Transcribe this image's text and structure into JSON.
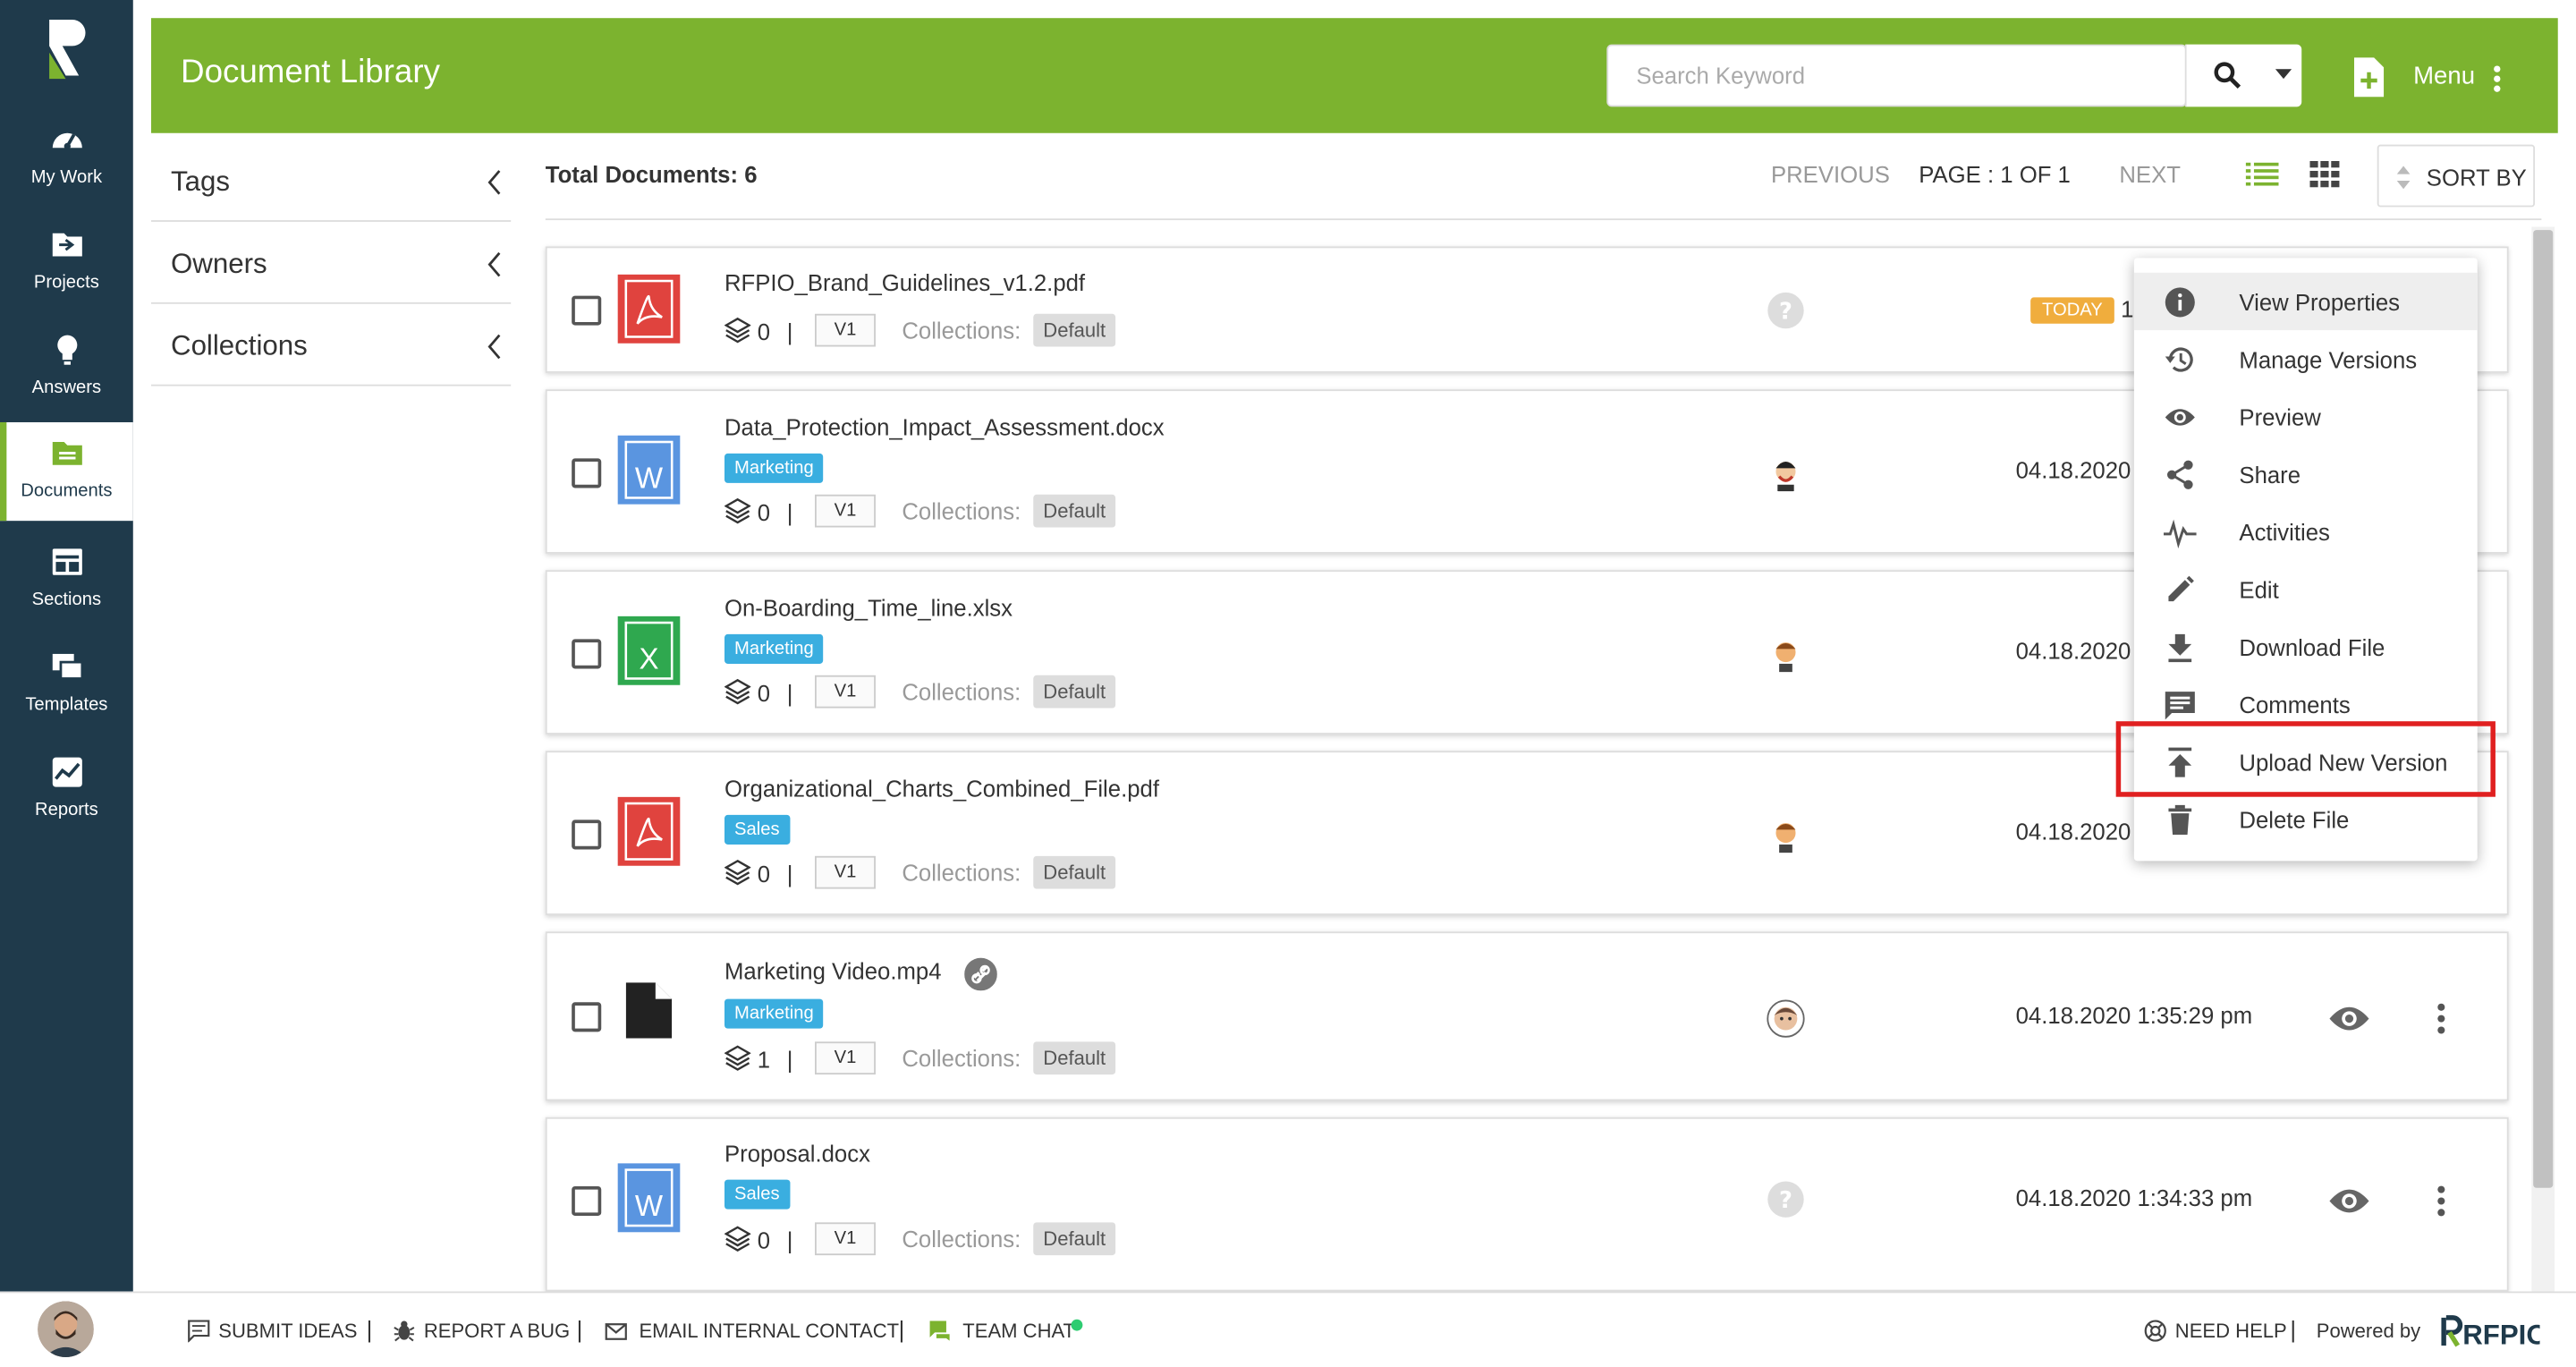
{
  "colors": {
    "brand_green": "#7cb32f",
    "nav_bg": "#1f3a4b",
    "tag_blue": "#3aaee0",
    "today_orange": "#f0ad3d",
    "highlight_red": "#e02020"
  },
  "nav": {
    "items": [
      {
        "label": "My Work",
        "icon": "speedometer-icon"
      },
      {
        "label": "Projects",
        "icon": "folder-open-icon"
      },
      {
        "label": "Answers",
        "icon": "lightbulb-icon"
      },
      {
        "label": "Documents",
        "icon": "documents-folder-icon",
        "active": true
      },
      {
        "label": "Sections",
        "icon": "sections-icon"
      },
      {
        "label": "Templates",
        "icon": "templates-icon"
      },
      {
        "label": "Reports",
        "icon": "reports-icon"
      }
    ]
  },
  "header": {
    "title": "Document Library",
    "search_placeholder": "Search Keyword",
    "menu_label": "Menu"
  },
  "filters": {
    "tags": "Tags",
    "owners": "Owners",
    "collections": "Collections"
  },
  "toolbar": {
    "total_label": "Total Documents:",
    "total_count": "6",
    "previous": "PREVIOUS",
    "page_info": "PAGE : 1 OF 1",
    "next": "NEXT",
    "sort_by": "SORT BY"
  },
  "documents": [
    {
      "name": "RFPIO_Brand_Guidelines_v1.2.pdf",
      "type": "pdf",
      "tag": "",
      "count": "0",
      "version": "V1",
      "collections_label": "Collections:",
      "collection": "Default",
      "badge": "TODAY",
      "date": "1"
    },
    {
      "name": "Data_Protection_Impact_Assessment.docx",
      "type": "word",
      "tag": "Marketing",
      "count": "0",
      "version": "V1",
      "collections_label": "Collections:",
      "collection": "Default",
      "date": "04.18.2020"
    },
    {
      "name": "On-Boarding_Time_line.xlsx",
      "type": "excel",
      "tag": "Marketing",
      "count": "0",
      "version": "V1",
      "collections_label": "Collections:",
      "collection": "Default",
      "date": "04.18.2020"
    },
    {
      "name": "Organizational_Charts_Combined_File.pdf",
      "type": "pdf",
      "tag": "Sales",
      "count": "0",
      "version": "V1",
      "collections_label": "Collections:",
      "collection": "Default",
      "date": "04.18.2020"
    },
    {
      "name": "Marketing Video.mp4",
      "type": "file",
      "tag": "Marketing",
      "count": "1",
      "version": "V1",
      "collections_label": "Collections:",
      "collection": "Default",
      "date": "04.18.2020 1:35:29 pm"
    },
    {
      "name": "Proposal.docx",
      "type": "word",
      "tag": "Sales",
      "count": "0",
      "version": "V1",
      "collections_label": "Collections:",
      "collection": "Default",
      "date": "04.18.2020 1:34:33 pm"
    }
  ],
  "context_menu": [
    {
      "label": "View Properties",
      "icon": "info-icon",
      "highlighted": true
    },
    {
      "label": "Manage Versions",
      "icon": "history-icon"
    },
    {
      "label": "Preview",
      "icon": "eye-icon"
    },
    {
      "label": "Share",
      "icon": "share-icon"
    },
    {
      "label": "Activities",
      "icon": "activity-pulse-icon"
    },
    {
      "label": "Edit",
      "icon": "pencil-icon"
    },
    {
      "label": "Download File",
      "icon": "download-icon"
    },
    {
      "label": "Comments",
      "icon": "comment-icon"
    },
    {
      "label": "Upload New Version",
      "icon": "upload-icon",
      "outlined": true
    },
    {
      "label": "Delete File",
      "icon": "trash-icon"
    }
  ],
  "footer": {
    "submit_ideas": "SUBMIT IDEAS",
    "report_bug": "REPORT A BUG",
    "email_contact": "EMAIL INTERNAL CONTACT",
    "team_chat": "TEAM CHAT",
    "need_help": "NEED HELP",
    "powered_by": "Powered by",
    "brand": "RFPIO"
  }
}
